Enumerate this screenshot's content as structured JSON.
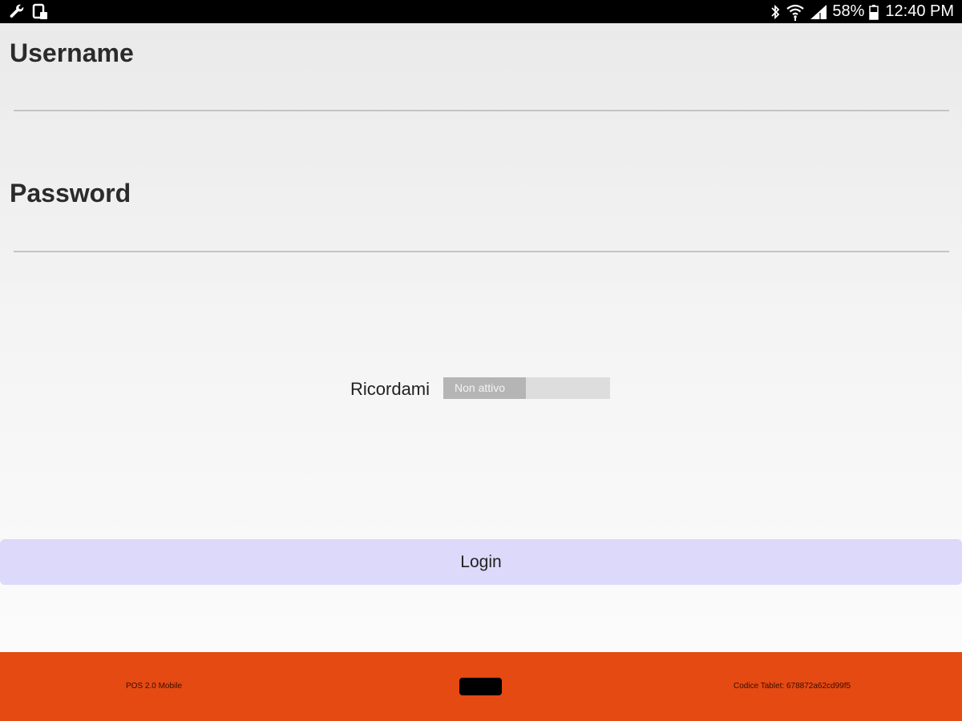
{
  "status_bar": {
    "left_icons": [
      "wrench-icon",
      "screen-cast-icon"
    ],
    "right_icons": [
      "bluetooth-icon",
      "wifi-icon",
      "cellular-signal-icon",
      "battery-icon"
    ],
    "battery_percent": "58%",
    "time": "12:40 PM"
  },
  "form": {
    "username_label": "Username",
    "username_value": "",
    "password_label": "Password",
    "password_value": ""
  },
  "remember": {
    "label": "Ricordami",
    "toggle_text": "Non attivo",
    "toggle_on": false
  },
  "login": {
    "label": "Login"
  },
  "footer": {
    "app_version": "POS 2.0 Mobile",
    "tablet_code": "Codice Tablet: 678872a62cd99f5"
  },
  "colors": {
    "status_bar": "#000000",
    "login_button": "#dcd9fa",
    "footer": "#e44a12",
    "toggle_off_track": "#dddddd",
    "toggle_off_thumb": "#b5b5b5"
  }
}
